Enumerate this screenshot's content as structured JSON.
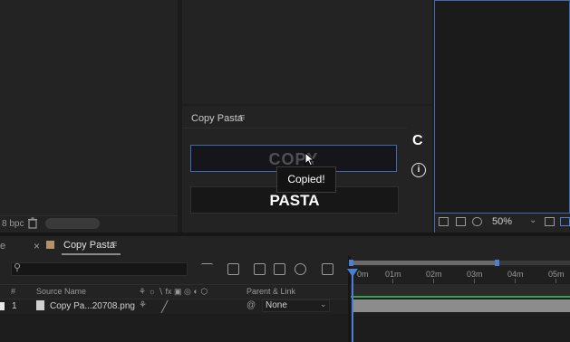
{
  "project_panel": {
    "bpc_label": "8 bpc"
  },
  "copy_pasta_panel": {
    "title": "Copy Pasta",
    "menu_glyph": "≡",
    "copy_label": "COPY",
    "paste_label": "PASTA",
    "tooltip": "Copied!",
    "logo_letter": "C",
    "info_glyph": "i"
  },
  "viewer_toolbar": {
    "zoom": "50%"
  },
  "timeline": {
    "tab_prev_label": "e",
    "tab_close": "×",
    "tab_name": "Copy Pasta",
    "tab_menu": "≡",
    "columns": {
      "num": "#",
      "source_name": "Source Name",
      "parent_link": "Parent & Link"
    },
    "layer": {
      "number": "1",
      "name": "Copy Pa...20708.png",
      "parent": "None"
    },
    "ruler_labels": [
      "0m",
      "01m",
      "02m",
      "03m",
      "04m",
      "05m"
    ]
  },
  "colors": {
    "accent_blue": "#3d6bb3",
    "playhead": "#4a7fd1",
    "label_swatch": "#b5916a",
    "track_green": "#2ea44f"
  }
}
